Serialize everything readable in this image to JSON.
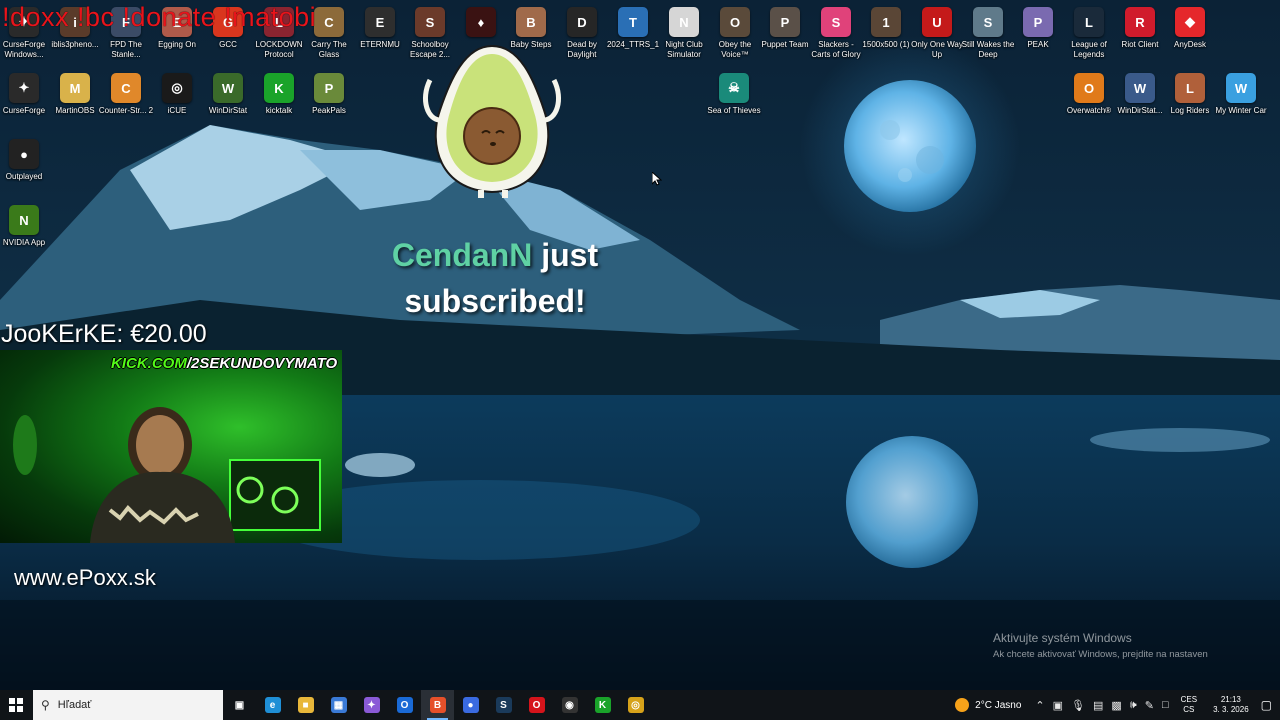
{
  "desktop": {
    "icons": [
      {
        "label": "CurseForge Windows...",
        "color": "#2a2a2a",
        "glyph": "✦"
      },
      {
        "label": "iblis3pheno...",
        "color": "#5a3b2a",
        "glyph": "i"
      },
      {
        "label": "FPD The Stanle...",
        "color": "#3b4b66",
        "glyph": "F"
      },
      {
        "label": "Egging On",
        "color": "#b05a4a",
        "glyph": "E"
      },
      {
        "label": "GCC",
        "color": "#d9361e",
        "glyph": "G"
      },
      {
        "label": "LOCKDOWN Protocol",
        "color": "#8a2430",
        "glyph": "L"
      },
      {
        "label": "Carry The Glass",
        "color": "#8c6a3a",
        "glyph": "C"
      },
      {
        "label": "ETERNMU",
        "color": "#2e2e2e",
        "glyph": "E"
      },
      {
        "label": "Schoolboy Escape 2...",
        "color": "#6b3a2a",
        "glyph": "S"
      },
      {
        "label": "",
        "color": "#3a1212",
        "glyph": "♦"
      },
      {
        "label": "Baby Steps",
        "color": "#a06a4a",
        "glyph": "B"
      },
      {
        "label": "Dead by Daylight",
        "color": "#262626",
        "glyph": "D"
      },
      {
        "label": "2024_TTRS_1",
        "color": "#2a6fb5",
        "glyph": "T"
      },
      {
        "label": "Night Club Simulator",
        "color": "#d6d6d6",
        "glyph": "N"
      },
      {
        "label": "Obey the Voice™",
        "color": "#5a4a3a",
        "glyph": "O"
      },
      {
        "label": "Puppet Team",
        "color": "#5a5048",
        "glyph": "P"
      },
      {
        "label": "Slackers - Carts of Glory",
        "color": "#e0427a",
        "glyph": "S"
      },
      {
        "label": "1500x500 (1)",
        "color": "#5a4636",
        "glyph": "1"
      },
      {
        "label": "Only One Way Up",
        "color": "#c41a1a",
        "glyph": "U"
      },
      {
        "label": "Still Wakes the Deep",
        "color": "#5f7a8a",
        "glyph": "S"
      },
      {
        "label": "PEAK",
        "color": "#7a6ab0",
        "glyph": "P"
      },
      {
        "label": "League of Legends",
        "color": "#1a2a3a",
        "glyph": "L"
      },
      {
        "label": "Riot Client",
        "color": "#d01b2c",
        "glyph": "R"
      },
      {
        "label": "AnyDesk",
        "color": "#e5272b",
        "glyph": "◆"
      },
      {
        "label": "CurseForge",
        "color": "#2a2a2a",
        "glyph": "✦"
      },
      {
        "label": "MartinOBS",
        "color": "#d9b24a",
        "glyph": "M"
      },
      {
        "label": "Counter-Str... 2",
        "color": "#e0882a",
        "glyph": "C"
      },
      {
        "label": "iCUE",
        "color": "#1a1a1a",
        "glyph": "◎"
      },
      {
        "label": "WinDirStat",
        "color": "#3a6a2a",
        "glyph": "W"
      },
      {
        "label": "kicktalk",
        "color": "#1aa32a",
        "glyph": "K"
      },
      {
        "label": "PeakPals",
        "color": "#6a8a3a",
        "glyph": "P"
      },
      {
        "label": "Sea of Thieves",
        "color": "#1a8a7a",
        "glyph": "☠"
      },
      {
        "label": "Overwatch®",
        "color": "#e07a1a",
        "glyph": "O"
      },
      {
        "label": "WinDirStat...",
        "color": "#3a5a8a",
        "glyph": "W"
      },
      {
        "label": "Log Riders",
        "color": "#b0603a",
        "glyph": "L"
      },
      {
        "label": "My Winter Car",
        "color": "#3aa0e0",
        "glyph": "W"
      },
      {
        "label": "Outplayed",
        "color": "#222222",
        "glyph": "●"
      },
      {
        "label": "NVIDIA App",
        "color": "#3a7a1a",
        "glyph": "N"
      }
    ]
  },
  "overlay": {
    "chat_commands": "!doxx !bc !donate !matobi",
    "donation": "JooKErKE: €20.00",
    "kick_banner_prefix": "KICK.COM",
    "kick_banner_suffix": "/2SEKUNDOVYMATO",
    "site_url": "www.ePoxx.sk",
    "sub_alert_name": "CendanN",
    "sub_alert_line1": "just",
    "sub_alert_line2": "subscribed!"
  },
  "watermark": {
    "title": "Aktivujte systém Windows",
    "subtitle": "Ak chcete aktivovať Windows, prejdite na nastaven"
  },
  "taskbar": {
    "search_placeholder": "Hľadať",
    "apps": [
      {
        "name": "task-view",
        "color": "transparent",
        "glyph": "▣"
      },
      {
        "name": "edge",
        "color": "#1f8fd6",
        "glyph": "e"
      },
      {
        "name": "file-explorer",
        "color": "#e8b73a",
        "glyph": "■"
      },
      {
        "name": "store",
        "color": "#3a7ad6",
        "glyph": "▦"
      },
      {
        "name": "copilot",
        "color": "#8a5ad6",
        "glyph": "✦"
      },
      {
        "name": "outlook",
        "color": "#1a6ad6",
        "glyph": "O"
      },
      {
        "name": "brave",
        "color": "#e5502a",
        "glyph": "B"
      },
      {
        "name": "app-blue",
        "color": "#3a6ae0",
        "glyph": "●"
      },
      {
        "name": "steam",
        "color": "#1a3a5a",
        "glyph": "S"
      },
      {
        "name": "opera",
        "color": "#d6141b",
        "glyph": "O"
      },
      {
        "name": "obs",
        "color": "#333333",
        "glyph": "◉"
      },
      {
        "name": "kick",
        "color": "#1aa32a",
        "glyph": "K"
      },
      {
        "name": "chrome",
        "color": "#d6a21a",
        "glyph": "◎"
      }
    ],
    "weather": "2°C Jasno",
    "lang_top": "CES",
    "lang_bottom": "CS",
    "time": "21:13",
    "date": "3. 3. 2026"
  }
}
